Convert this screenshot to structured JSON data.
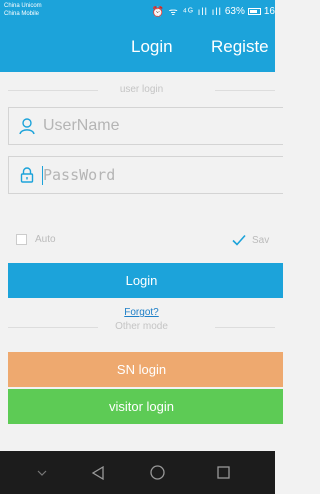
{
  "status_bar": {
    "carriers": [
      "China Unicom",
      "China Mobile"
    ],
    "icons": "⏰ ᯤ ⁴ᴳ ıll ıll",
    "battery": "63%",
    "time": "16"
  },
  "header": {
    "tab_login": "Login",
    "tab_register": "Registe"
  },
  "form": {
    "section_title": "user login",
    "username_placeholder": "UserName",
    "password_placeholder": "PassWord",
    "auto_label": "Auto",
    "save_label": "Sav",
    "auto_checked": false,
    "save_checked": true,
    "login_button": "Login",
    "forgot_link": "Forgot?"
  },
  "other": {
    "section_title": "Other mode",
    "sn_login_button": "SN login",
    "visitor_login_button": "visitor login"
  },
  "nav_bar": {
    "icons": [
      "chevron-down-icon",
      "back-icon",
      "home-icon",
      "recents-icon"
    ]
  },
  "colors": {
    "primary": "#1ca3da",
    "sn_button": "#eea96f",
    "visitor_button": "#5dcb55",
    "link": "#1e7fc7",
    "background": "#f2f2f2"
  }
}
